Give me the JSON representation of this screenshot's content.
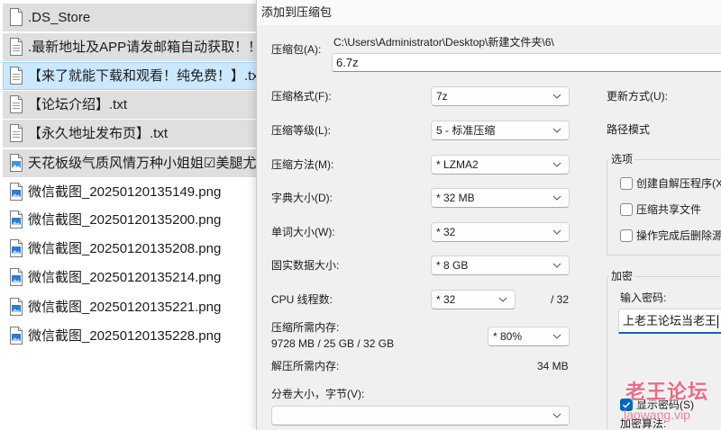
{
  "file_list": {
    "items": [
      {
        "name": ".DS_Store",
        "icon": "file-icon",
        "selected": true
      },
      {
        "name": ".最新地址及APP请发邮箱自动获取！！！.",
        "icon": "txt-file-icon",
        "selected": true
      },
      {
        "name": "【来了就能下载和观看！纯免费！】.txt",
        "icon": "txt-file-icon",
        "selected": true,
        "focused": true
      },
      {
        "name": "【论坛介绍】.txt",
        "icon": "txt-file-icon",
        "selected": true
      },
      {
        "name": "【永久地址发布页】.txt",
        "icon": "txt-file-icon",
        "selected": true
      },
      {
        "name": "天花板级气质风情万种小姐姐☑美腿尤物魔",
        "icon": "image-file-icon",
        "selected": true
      },
      {
        "name": "微信截图_20250120135149.png",
        "icon": "png-file-icon",
        "selected": false
      },
      {
        "name": "微信截图_20250120135200.png",
        "icon": "png-file-icon",
        "selected": false
      },
      {
        "name": "微信截图_20250120135208.png",
        "icon": "png-file-icon",
        "selected": false
      },
      {
        "name": "微信截图_20250120135214.png",
        "icon": "png-file-icon",
        "selected": false
      },
      {
        "name": "微信截图_20250120135221.png",
        "icon": "png-file-icon",
        "selected": false
      },
      {
        "name": "微信截图_20250120135228.png",
        "icon": "png-file-icon",
        "selected": false
      }
    ]
  },
  "dialog": {
    "title": "添加到压缩包",
    "archive": {
      "label": "压缩包(A):",
      "path": "C:\\Users\\Administrator\\Desktop\\新建文件夹\\6\\",
      "name": "6.7z"
    },
    "settings": {
      "format": {
        "label": "压缩格式(F):",
        "value": "7z"
      },
      "level": {
        "label": "压缩等级(L):",
        "value": "5 - 标准压缩"
      },
      "method": {
        "label": "压缩方法(M):",
        "value": "* LZMA2"
      },
      "dictionary": {
        "label": "字典大小(D):",
        "value": "* 32 MB"
      },
      "word": {
        "label": "单词大小(W):",
        "value": "* 32"
      },
      "solid": {
        "label": "固实数据大小:",
        "value": "* 8 GB"
      },
      "threads": {
        "label": "CPU 线程数:",
        "value": "* 32",
        "max": "/ 32"
      },
      "memory_compress": {
        "label": "压缩所需内存:",
        "detail": "9728 MB / 25 GB / 32 GB",
        "value": "* 80%"
      },
      "memory_decompress": {
        "label": "解压所需内存:",
        "value": "34 MB"
      },
      "volume": {
        "label": "分卷大小，字节(V):",
        "value": ""
      }
    },
    "update_mode": {
      "label": "更新方式(U):"
    },
    "path_mode": {
      "label": "路径模式"
    },
    "options": {
      "title": "选项",
      "items": [
        {
          "label": "创建自解压程序(X",
          "checked": false
        },
        {
          "label": "压缩共享文件",
          "checked": false
        },
        {
          "label": "操作完成后删除源",
          "checked": false
        }
      ]
    },
    "encryption": {
      "title": "加密",
      "password_label": "输入密码:",
      "password": "上老王论坛当老王",
      "show_password": {
        "label": "显示密码(S)",
        "checked": true
      },
      "method_label": "加密算法:"
    }
  },
  "watermark": {
    "title": "老王论坛",
    "url": "laowang.vip"
  },
  "colors": {
    "selection_focused": "#cce8ff",
    "selection_focused_border": "#99d1ff",
    "selection_inactive": "#dfdfdf",
    "dialog_background": "#f0f0f0",
    "accent": "#0067c0",
    "watermark": "#e9506e"
  }
}
